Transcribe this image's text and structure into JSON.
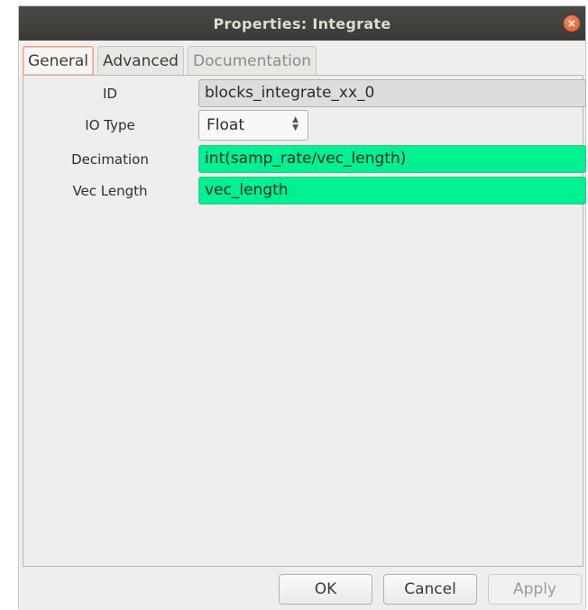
{
  "window": {
    "title": "Properties: Integrate",
    "close_icon": "×"
  },
  "tabs": [
    {
      "label": "General",
      "active": true,
      "enabled": true
    },
    {
      "label": "Advanced",
      "active": false,
      "enabled": true
    },
    {
      "label": "Documentation",
      "active": false,
      "enabled": false
    }
  ],
  "params": {
    "id": {
      "label": "ID",
      "value": "blocks_integrate_xx_0"
    },
    "io_type": {
      "label": "IO Type",
      "value": "Float"
    },
    "decimation": {
      "label": "Decimation",
      "value": "int(samp_rate/vec_length)"
    },
    "vec_length": {
      "label": "Vec Length",
      "value": "vec_length"
    }
  },
  "buttons": {
    "ok": "OK",
    "cancel": "Cancel",
    "apply": "Apply"
  },
  "colors": {
    "valid_field": "#00f092",
    "readonly_field": "#dedddb",
    "active_tab_border": "#f0a285",
    "close_button": "#e35423"
  }
}
